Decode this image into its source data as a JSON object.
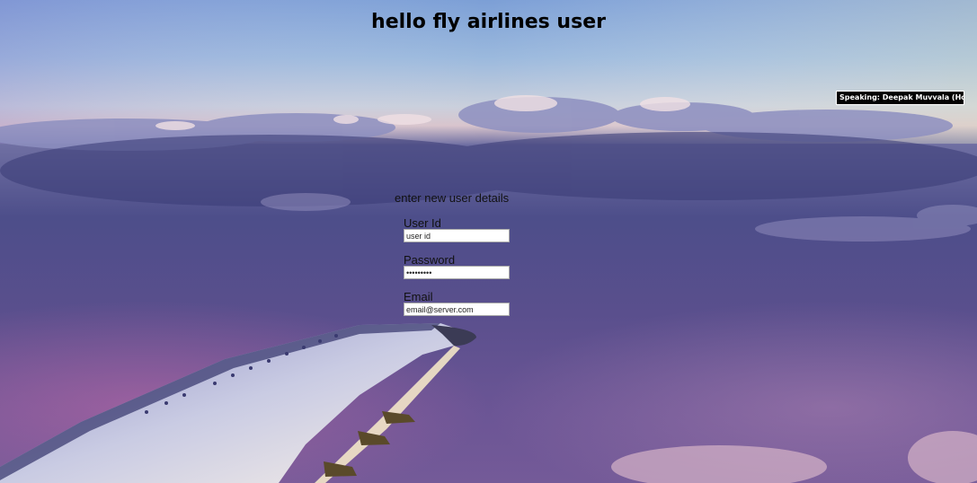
{
  "header": {
    "title": "hello fly airlines user"
  },
  "meeting_overlay": {
    "speaking_text": "Speaking: Deepak Muvvala (Host)"
  },
  "form": {
    "heading": "enter new user details",
    "fields": [
      {
        "label": "User Id",
        "placeholder": "user id",
        "value": "",
        "type": "text"
      },
      {
        "label": "Password",
        "placeholder": "",
        "value": "•••••••••",
        "type": "password"
      },
      {
        "label": "Email",
        "placeholder": "email@server.com",
        "value": "",
        "type": "text"
      }
    ]
  },
  "colors": {
    "sky_top": "#7fa6d8",
    "sky_horizon": "#e9d6c8",
    "cloud_deep": "#3f3f7a",
    "cloud_purple": "#7a5a94",
    "wing": "#c7c9dc",
    "badge_bg": "#000000"
  }
}
